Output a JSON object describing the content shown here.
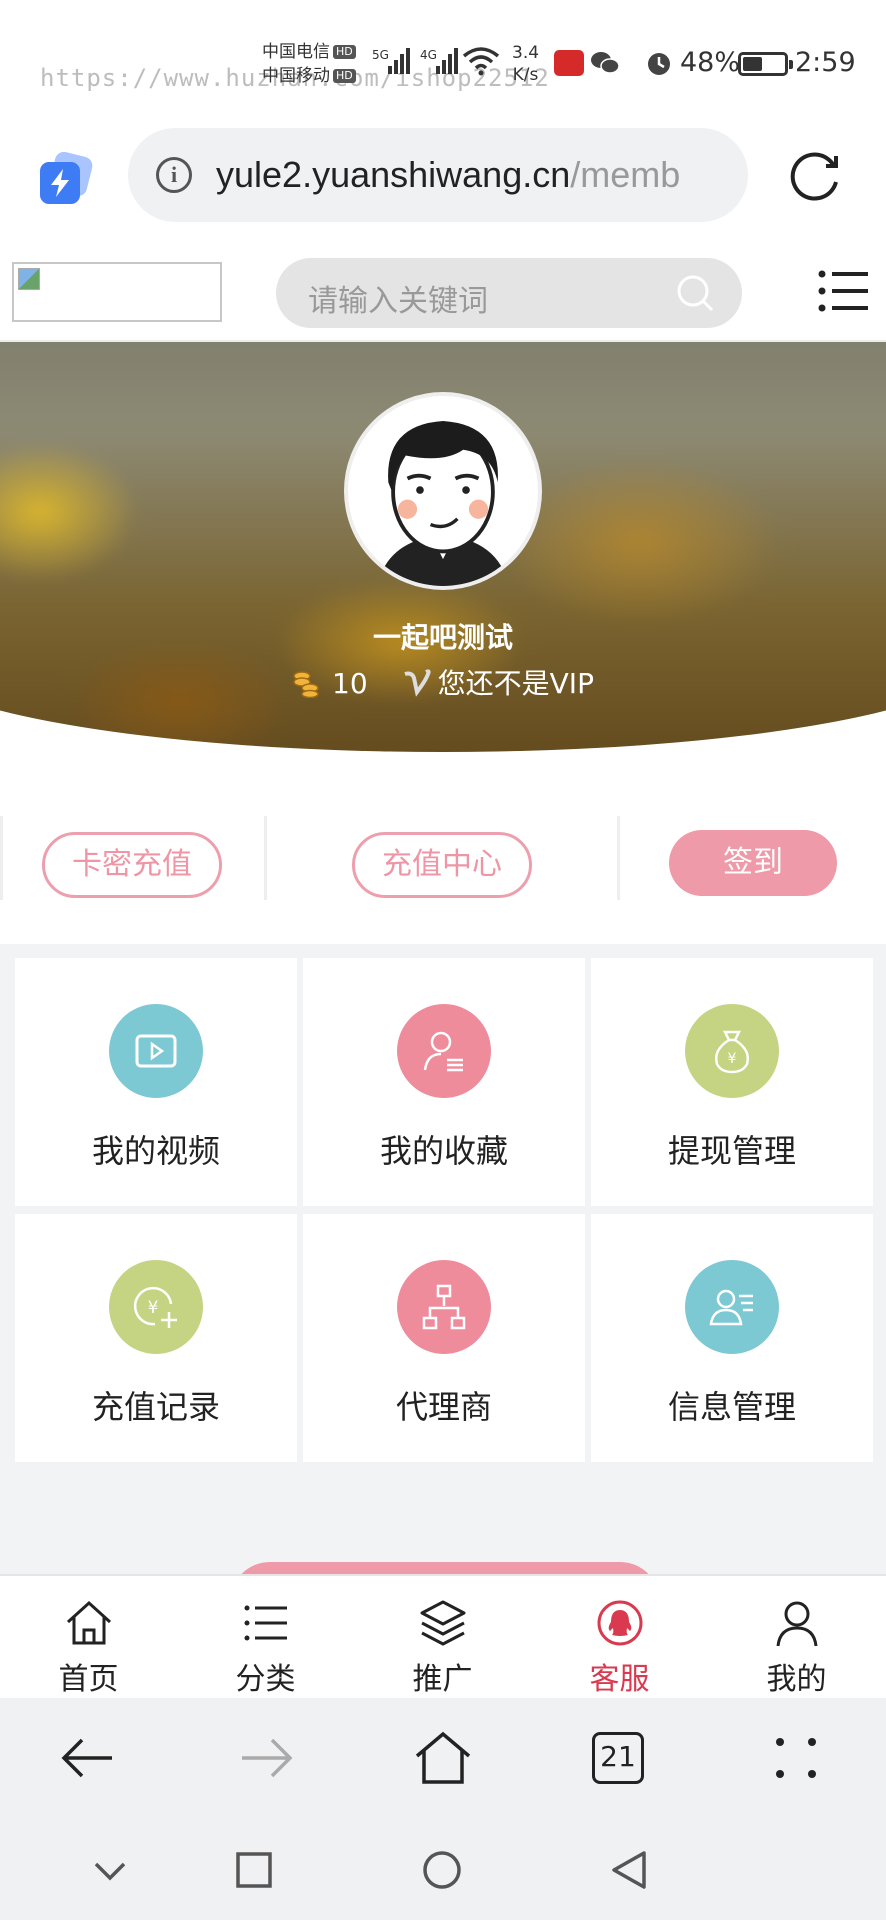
{
  "status_bar": {
    "carrier1": "中国电信",
    "carrier2": "中国移动",
    "hd": "HD",
    "net1": "5G",
    "net2": "4G",
    "speed_value": "3.4",
    "speed_unit": "K/s",
    "battery": "48%",
    "time": "2:59",
    "watermark": "https://www.huzhan.com/ishop22512"
  },
  "browser": {
    "url_main": "yule2.yuanshiwang.cn",
    "url_rest": "/memb"
  },
  "header": {
    "search_placeholder": "请输入关键词"
  },
  "profile": {
    "username": "一起吧测试",
    "coins": "10",
    "vip_status": "您还不是VIP"
  },
  "actions": {
    "card_recharge": "卡密充值",
    "recharge_center": "充值中心",
    "checkin": "签到"
  },
  "grid": [
    {
      "label": "我的视频",
      "color": "#7cc8d3"
    },
    {
      "label": "我的收藏",
      "color": "#ee8c9c"
    },
    {
      "label": "提现管理",
      "color": "#c4d482"
    },
    {
      "label": "充值记录",
      "color": "#c4d482"
    },
    {
      "label": "代理商",
      "color": "#ee8c9c"
    },
    {
      "label": "信息管理",
      "color": "#7cc8d3"
    }
  ],
  "tabs": [
    {
      "label": "首页",
      "icon": "home-icon"
    },
    {
      "label": "分类",
      "icon": "list-icon"
    },
    {
      "label": "推广",
      "icon": "layers-icon"
    },
    {
      "label": "客服",
      "icon": "qq-icon"
    },
    {
      "label": "我的",
      "icon": "user-icon"
    }
  ],
  "browser_toolbar": {
    "tab_count": "21"
  },
  "colors": {
    "accent_pink": "#ee9aa8",
    "active_tab": "#d93a4f"
  }
}
